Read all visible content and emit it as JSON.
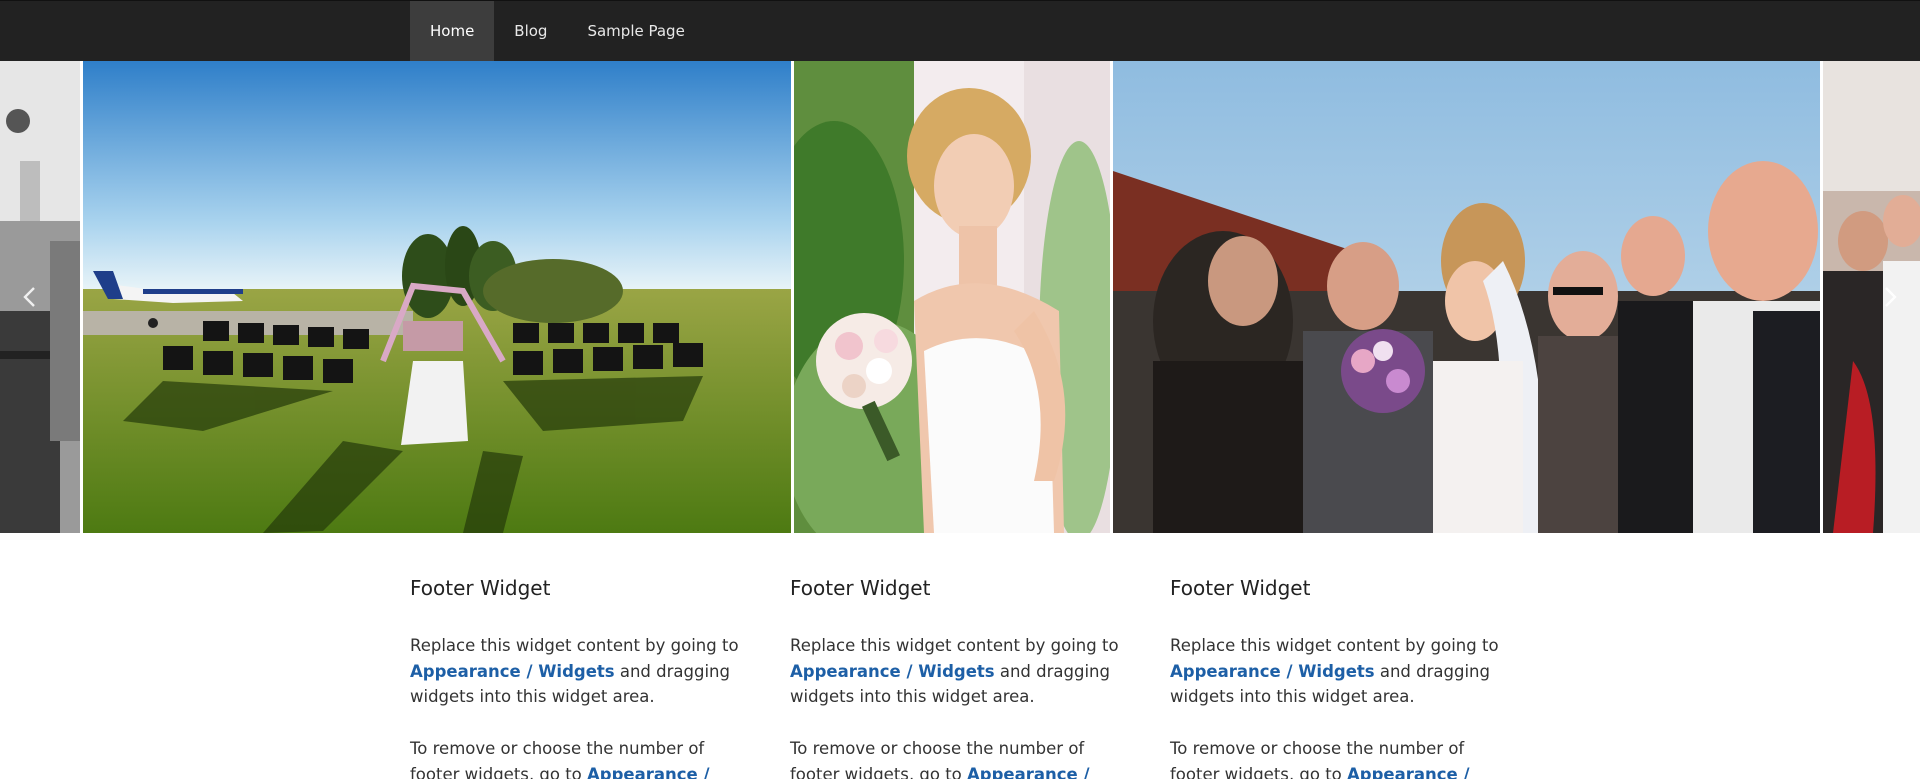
{
  "nav": {
    "items": [
      {
        "label": "Home",
        "active": true
      },
      {
        "label": "Blog",
        "active": false
      },
      {
        "label": "Sample Page",
        "active": false
      }
    ]
  },
  "slider": {
    "slides": [
      {
        "subject": "black and white interior with lamp"
      },
      {
        "subject": "outdoor wedding ceremony chairs on airfield with small airplane"
      },
      {
        "subject": "bride holding bouquet"
      },
      {
        "subject": "bride and groom with wedding guests"
      },
      {
        "subject": "wedding guests celebrating"
      }
    ],
    "prev_icon": "chevron-left-icon",
    "next_icon": "chevron-right-icon"
  },
  "widgets": [
    {
      "title": "Footer Widget",
      "p1_before": "Replace this widget content by going to ",
      "p1_link": "Appearance / Widgets",
      "p1_after": " and dragging widgets into this widget area.",
      "p2_before": "To remove or choose the number of footer widgets, go to ",
      "p2_link": "Appearance / Customize /"
    },
    {
      "title": "Footer Widget",
      "p1_before": "Replace this widget content by going to ",
      "p1_link": "Appearance / Widgets",
      "p1_after": " and dragging widgets into this widget area.",
      "p2_before": "To remove or choose the number of footer widgets, go to ",
      "p2_link": "Appearance / Customize /"
    },
    {
      "title": "Footer Widget",
      "p1_before": "Replace this widget content by going to ",
      "p1_link": "Appearance / Widgets",
      "p1_after": " and dragging widgets into this widget area.",
      "p2_before": "To remove or choose the number of footer widgets, go to ",
      "p2_link": "Appearance / Customize /"
    }
  ],
  "colors": {
    "nav_bg": "#222222",
    "nav_active_bg": "#3d3d3d",
    "link": "#1d5fa6"
  }
}
